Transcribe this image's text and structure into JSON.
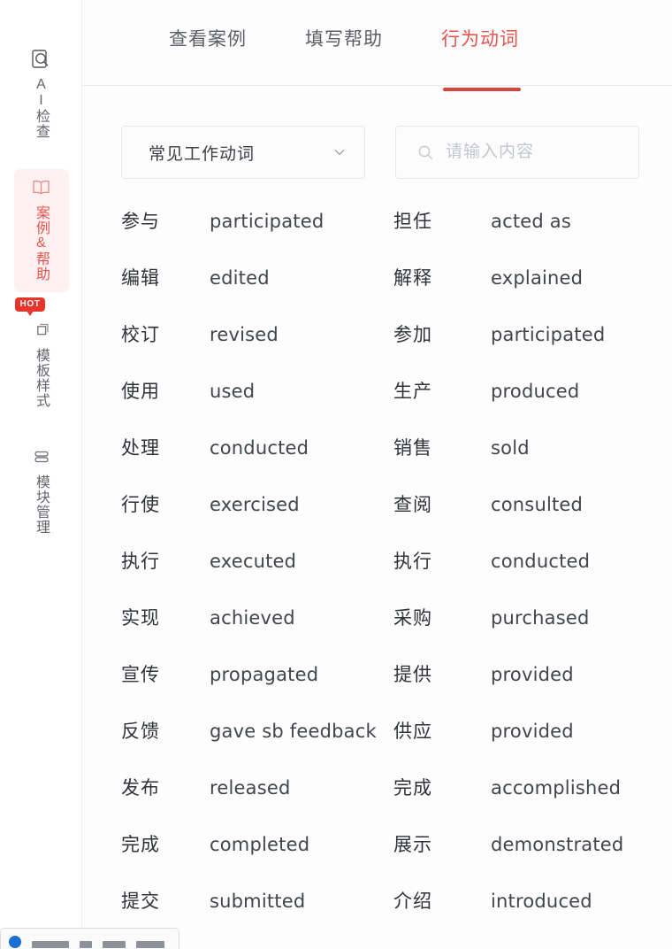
{
  "sidebar": {
    "items": [
      {
        "id": "ai-check",
        "label": "AI检查",
        "icon": "doc-search-icon",
        "active": false,
        "badge": null
      },
      {
        "id": "cases-help",
        "label": "案例&帮助",
        "icon": "open-book-icon",
        "active": true,
        "badge": null
      },
      {
        "id": "template-style",
        "label": "模板样式",
        "icon": "layers-icon",
        "active": false,
        "badge": "HOT"
      },
      {
        "id": "module-manage",
        "label": "模块管理",
        "icon": "modules-icon",
        "active": false,
        "badge": null
      }
    ]
  },
  "tabs": [
    {
      "id": "view-cases",
      "label": "查看案例",
      "active": false
    },
    {
      "id": "fill-help",
      "label": "填写帮助",
      "active": false
    },
    {
      "id": "action-verbs",
      "label": "行为动词",
      "active": true
    }
  ],
  "controls": {
    "category_select": {
      "value": "常见工作动词",
      "icon": "chevron-down-icon"
    },
    "search": {
      "value": "",
      "placeholder": "请输入内容",
      "icon": "search-icon"
    }
  },
  "verbs": {
    "left_column": [
      {
        "cn": "参与",
        "en": "participated"
      },
      {
        "cn": "编辑",
        "en": "edited"
      },
      {
        "cn": "校订",
        "en": "revised"
      },
      {
        "cn": "使用",
        "en": "used"
      },
      {
        "cn": "处理",
        "en": "conducted"
      },
      {
        "cn": "行使",
        "en": "exercised"
      },
      {
        "cn": "执行",
        "en": "executed"
      },
      {
        "cn": "实现",
        "en": "achieved"
      },
      {
        "cn": "宣传",
        "en": "propagated"
      },
      {
        "cn": "反馈",
        "en": "gave sb feedback"
      },
      {
        "cn": "发布",
        "en": "released"
      },
      {
        "cn": "完成",
        "en": "completed"
      },
      {
        "cn": "提交",
        "en": "submitted"
      }
    ],
    "right_column": [
      {
        "cn": "担任",
        "en": "acted as"
      },
      {
        "cn": "解释",
        "en": "explained"
      },
      {
        "cn": "参加",
        "en": "participated"
      },
      {
        "cn": "生产",
        "en": "produced"
      },
      {
        "cn": "销售",
        "en": "sold"
      },
      {
        "cn": "查阅",
        "en": "consulted"
      },
      {
        "cn": "执行",
        "en": "conducted"
      },
      {
        "cn": "采购",
        "en": "purchased"
      },
      {
        "cn": "提供",
        "en": "provided"
      },
      {
        "cn": "供应",
        "en": "provided"
      },
      {
        "cn": "完成",
        "en": "accomplished"
      },
      {
        "cn": "展示",
        "en": "demonstrated"
      },
      {
        "cn": "介绍",
        "en": "introduced"
      }
    ]
  },
  "colors": {
    "accent": "#e8544d",
    "accent_underline": "#d9453c",
    "hot_badge": "#e8352b",
    "text_primary": "#2f3238",
    "text_secondary": "#63666d",
    "border": "#e6e8ee",
    "panel_bg": "#fdfdfe"
  }
}
